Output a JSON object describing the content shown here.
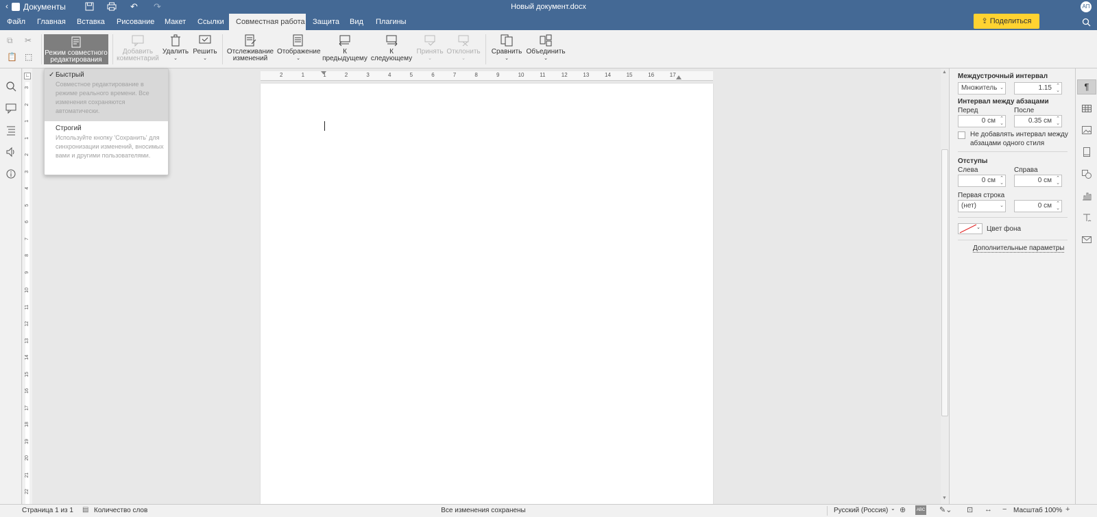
{
  "app": {
    "name": "Документы",
    "doc_title": "Новый документ.docx",
    "user_initials": "АП"
  },
  "menu": {
    "tabs": [
      "Файл",
      "Главная",
      "Вставка",
      "Рисование",
      "Макет",
      "Ссылки",
      "Совместная работа",
      "Защита",
      "Вид",
      "Плагины"
    ],
    "active_tab": "Совместная работа",
    "share_label": "Поделиться"
  },
  "toolbar": {
    "coedit_label_1": "Режим совместного",
    "coedit_label_2": "редактирования",
    "add_comment_1": "Добавить",
    "add_comment_2": "комментарий",
    "delete": "Удалить",
    "resolve": "Решить",
    "track_1": "Отслеживание",
    "track_2": "изменений",
    "display": "Отображение",
    "prev_1": "К",
    "prev_2": "предыдущему",
    "next_1": "К",
    "next_2": "следующему",
    "accept": "Принять",
    "reject": "Отклонить",
    "compare": "Сравнить",
    "merge": "Объединить"
  },
  "dropdown": {
    "fast_title": "Быстрый",
    "fast_desc": "Совместное редактирование в режиме реального времени. Все изменения сохраняются автоматически.",
    "strict_title": "Строгий",
    "strict_desc": "Используйте кнопку 'Сохранить' для синхронизации изменений, вносимых вами и другими пользователями."
  },
  "panel": {
    "line_spacing": "Междустрочный интервал",
    "line_mode": "Множитель",
    "line_value": "1.15",
    "para_spacing": "Интервал между абзацами",
    "before_label": "Перед",
    "after_label": "После",
    "before_value": "0 см",
    "after_value": "0.35 см",
    "no_add_1": "Не добавлять интервал между",
    "no_add_2": "абзацами одного стиля",
    "indents": "Отступы",
    "left_label": "Слева",
    "right_label": "Справа",
    "left_value": "0 см",
    "right_value": "0 см",
    "first_line": "Первая строка",
    "first_mode": "(нет)",
    "first_value": "0 см",
    "bg_color": "Цвет фона",
    "advanced": "Дополнительные параметры"
  },
  "status": {
    "page": "Страница 1 из 1",
    "word_count": "Количество слов",
    "saved": "Все изменения сохранены",
    "language": "Русский (Россия)",
    "zoom": "Масштаб 100%"
  },
  "ruler": {
    "h_ticks": [
      "2",
      "1",
      "1",
      "2",
      "3",
      "4",
      "5",
      "6",
      "7",
      "8",
      "9",
      "10",
      "11",
      "12",
      "13",
      "14",
      "15",
      "16",
      "17"
    ],
    "v_ticks": [
      "3",
      "2",
      "1",
      "1",
      "2",
      "3",
      "4",
      "5",
      "6",
      "7",
      "8",
      "9",
      "10",
      "11",
      "12",
      "13",
      "14",
      "15",
      "16",
      "17",
      "18",
      "19",
      "20",
      "21",
      "22"
    ]
  },
  "colors": {
    "header": "#446995",
    "share": "#ffd331",
    "bg": "#e8e8e8"
  }
}
